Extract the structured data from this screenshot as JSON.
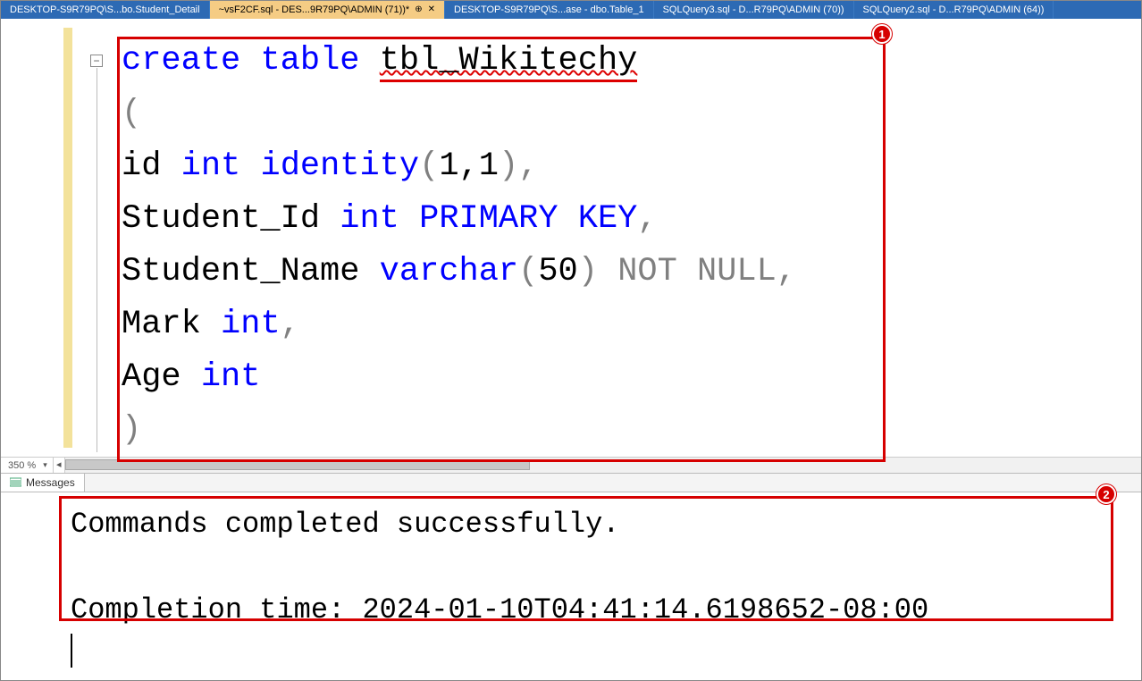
{
  "tabs": [
    {
      "label": "DESKTOP-S9R79PQ\\S...bo.Student_Detail",
      "active": false
    },
    {
      "label": "~vsF2CF.sql - DES...9R79PQ\\ADMIN (71))*",
      "active": true,
      "pinned": true,
      "closable": true
    },
    {
      "label": "DESKTOP-S9R79PQ\\S...ase - dbo.Table_1",
      "active": false
    },
    {
      "label": "SQLQuery3.sql - D...R79PQ\\ADMIN (70))",
      "active": false
    },
    {
      "label": "SQLQuery2.sql - D...R79PQ\\ADMIN (64))",
      "active": false
    }
  ],
  "code": {
    "line1": {
      "kw1": "create",
      "kw2": "table",
      "ident": "tbl_Wikitechy"
    },
    "line2": "(",
    "line3": {
      "col": "id",
      "type": "int",
      "ident": "identity",
      "args": "1,1",
      "trail": ","
    },
    "line4": {
      "col": "Student_Id",
      "type": "int",
      "constraint": "PRIMARY KEY",
      "trail": ","
    },
    "line5": {
      "col": "Student_Name",
      "type": "varchar",
      "args": "50",
      "constraint": "NOT NULL",
      "trail": ","
    },
    "line6": {
      "col": "Mark",
      "type": "int",
      "trail": ","
    },
    "line7": {
      "col": "Age",
      "type": "int"
    },
    "line8": ")"
  },
  "zoom": "350 %",
  "collapse_glyph": "−",
  "pin_glyph": "⊕",
  "close_glyph": "✕",
  "messages_tab": "Messages",
  "messages": {
    "line1": "Commands completed successfully.",
    "blank": "",
    "line2_prefix": "Completion time: ",
    "line2_time": "2024-01-10T04:41:14.6198652-08:00"
  },
  "badges": {
    "one": "1",
    "two": "2"
  }
}
